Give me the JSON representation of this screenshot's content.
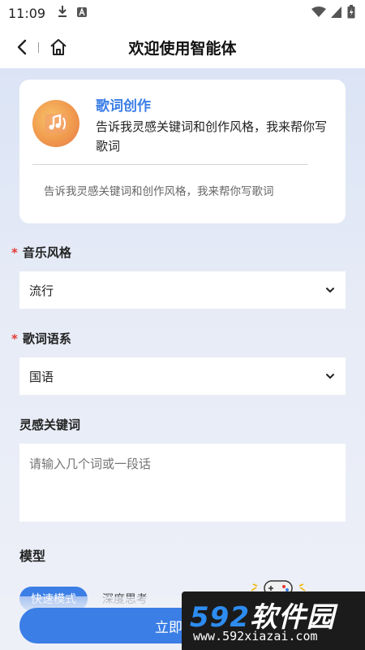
{
  "status_bar": {
    "time": "11:09"
  },
  "nav": {
    "title": "欢迎使用智能体"
  },
  "agent": {
    "name": "歌词创作",
    "description": "告诉我灵感关键词和创作风格，我来帮你写歌词",
    "hint": "告诉我灵感关键词和创作风格，我来帮你写歌词"
  },
  "form": {
    "music_style": {
      "required_mark": "*",
      "label": "音乐风格",
      "value": "流行"
    },
    "lyric_language": {
      "required_mark": "*",
      "label": "歌词语系",
      "value": "国语"
    },
    "keywords": {
      "label": "灵感关键词",
      "placeholder": "请输入几个词或一段话"
    },
    "model": {
      "label": "模型",
      "modes": [
        "快速模式",
        "深度思考"
      ]
    }
  },
  "submit": {
    "label": "立即生成"
  },
  "watermark": {
    "digits": "592",
    "brand": "软件园",
    "url": "www.592xiazai.com"
  },
  "colors": {
    "accent": "#3a7ee6",
    "required": "#e53935"
  }
}
